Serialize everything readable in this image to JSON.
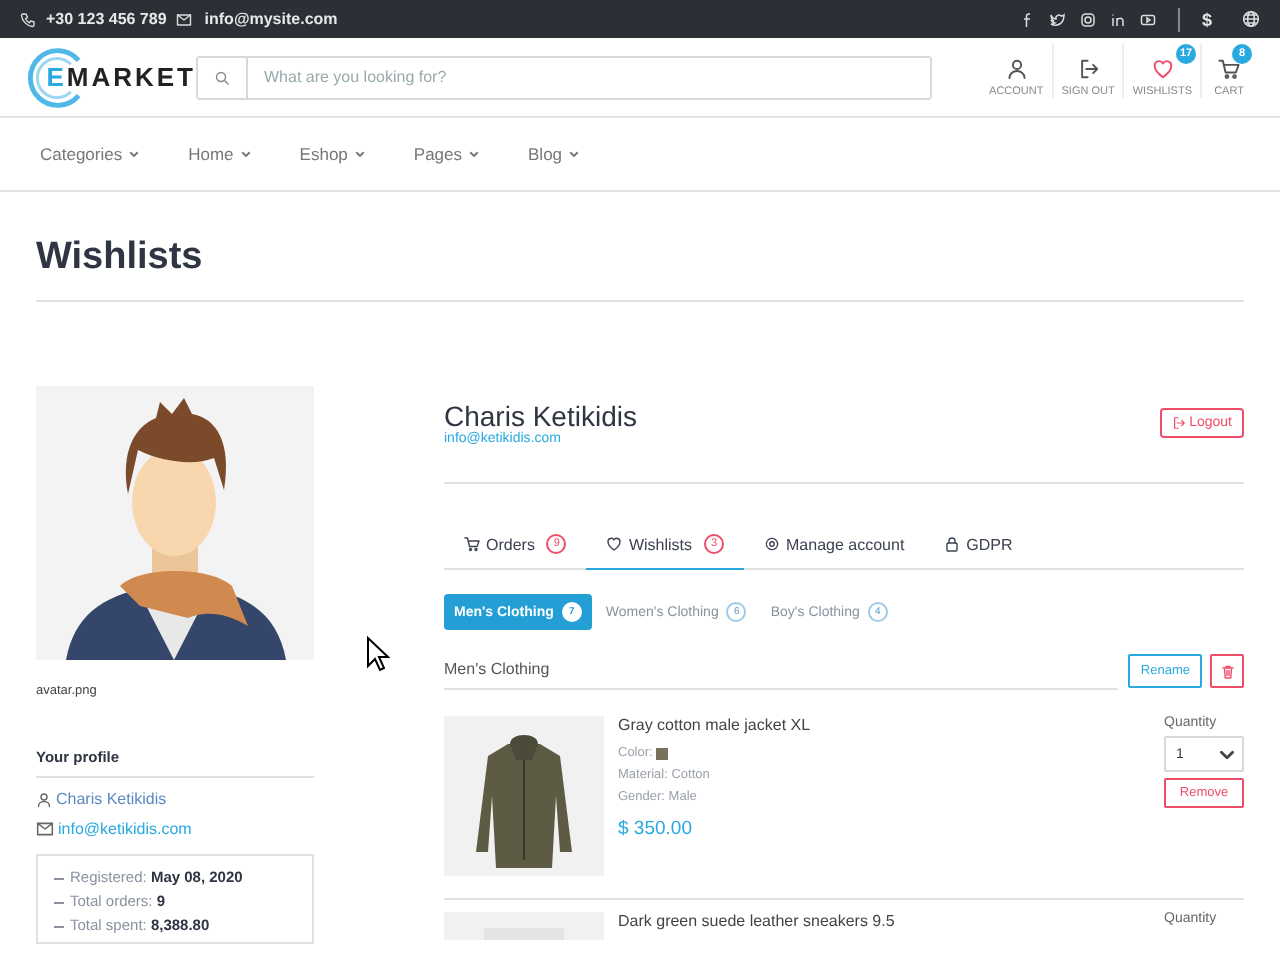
{
  "topbar": {
    "phone": "+30 123 456 789",
    "email": "info@mysite.com",
    "currency": "$"
  },
  "header": {
    "logo": [
      "E",
      "MARKET"
    ],
    "search": {
      "placeholder": "What are you looking for?"
    },
    "actions": [
      {
        "label": "ACCOUNT"
      },
      {
        "label": "SIGN OUT"
      },
      {
        "label": "WISHLISTS",
        "badge": "17"
      },
      {
        "label": "CART",
        "badge": "8"
      }
    ]
  },
  "nav": [
    "Categories",
    "Home",
    "Eshop",
    "Pages",
    "Blog"
  ],
  "page_title": "Wishlists",
  "profile": {
    "avatar_caption": "avatar.png",
    "section_title": "Your profile",
    "name": "Charis Ketikidis",
    "email": "info@ketikidis.com",
    "stats": [
      {
        "label": "Registered:",
        "value": "May 08, 2020"
      },
      {
        "label": "Total orders:",
        "value": "9"
      },
      {
        "label": "Total spent:",
        "value": "8,388.80"
      }
    ]
  },
  "account": {
    "name": "Charis Ketikidis",
    "email": "info@ketikidis.com",
    "logout": "Logout",
    "tabs": [
      {
        "label": "Orders",
        "count": "9",
        "selected": false
      },
      {
        "label": "Wishlists",
        "count": "3",
        "selected": true
      },
      {
        "label": "Manage account",
        "selected": false
      },
      {
        "label": "GDPR",
        "selected": false
      }
    ],
    "lists": [
      {
        "label": "Men's Clothing",
        "count": "7",
        "selected": true
      },
      {
        "label": "Women's Clothing",
        "count": "6",
        "selected": false
      },
      {
        "label": "Boy's Clothing",
        "count": "4",
        "selected": false
      }
    ],
    "list_title": "Men's Clothing",
    "rename": "Rename",
    "items": [
      {
        "title": "Gray cotton male jacket XL",
        "color_label": "Color:",
        "color": "#7a705e",
        "material": "Material: Cotton",
        "gender": "Gender: Male",
        "price": "$ 350.00",
        "quantity_label": "Quantity",
        "quantity": "1",
        "remove": "Remove"
      },
      {
        "title": "Dark green suede leather sneakers 9.5",
        "quantity_label": "Quantity"
      }
    ]
  }
}
